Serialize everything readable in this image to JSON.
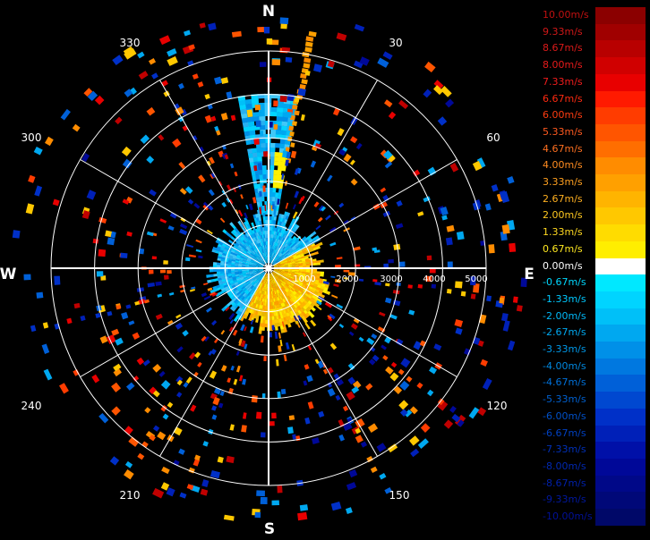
{
  "compass": {
    "north": "N",
    "east": "E",
    "south": "S",
    "west": "W"
  },
  "azimuth_labels": [
    "30",
    "60",
    "120",
    "150",
    "210",
    "240",
    "300",
    "330"
  ],
  "range_labels": [
    "1000",
    "2000",
    "3000",
    "4000",
    "5000"
  ],
  "colors": {
    "background": "#000000",
    "grid": "#ffffff",
    "zero": "#ffffff"
  },
  "legend": [
    {
      "label": "10.00m/s",
      "color": "#8b0000",
      "text_color": "#c01010"
    },
    {
      "label": "9.33m/s",
      "color": "#a00000",
      "text_color": "#d01818"
    },
    {
      "label": "8.67m/s",
      "color": "#b80000",
      "text_color": "#dc1a1a"
    },
    {
      "label": "8.00m/s",
      "color": "#d00000",
      "text_color": "#e81a1a"
    },
    {
      "label": "7.33m/s",
      "color": "#e80000",
      "text_color": "#f01c1c"
    },
    {
      "label": "6.67m/s",
      "color": "#ff1a00",
      "text_color": "#ff2a10"
    },
    {
      "label": "6.00m/s",
      "color": "#ff3c00",
      "text_color": "#ff3c10"
    },
    {
      "label": "5.33m/s",
      "color": "#ff5500",
      "text_color": "#ff5a20"
    },
    {
      "label": "4.67m/s",
      "color": "#ff6e00",
      "text_color": "#ff7020"
    },
    {
      "label": "4.00m/s",
      "color": "#ff8c00",
      "text_color": "#ff8c20"
    },
    {
      "label": "3.33m/s",
      "color": "#ffa000",
      "text_color": "#ffa020"
    },
    {
      "label": "2.67m/s",
      "color": "#ffb400",
      "text_color": "#ffb020"
    },
    {
      "label": "2.00m/s",
      "color": "#ffc800",
      "text_color": "#ffc820"
    },
    {
      "label": "1.33m/s",
      "color": "#ffdc00",
      "text_color": "#ffd820"
    },
    {
      "label": "0.67m/s",
      "color": "#ffee00",
      "text_color": "#ffe820"
    },
    {
      "label": "0.00m/s",
      "color": "#ffffff",
      "text_color": "#ffffff"
    },
    {
      "label": "-0.67m/s",
      "color": "#00e8ff",
      "text_color": "#00d8ff"
    },
    {
      "label": "-1.33m/s",
      "color": "#00d4ff",
      "text_color": "#00c8ff"
    },
    {
      "label": "-2.00m/s",
      "color": "#00c0f8",
      "text_color": "#00b8f8"
    },
    {
      "label": "-2.67m/s",
      "color": "#00a8f0",
      "text_color": "#00a8f0"
    },
    {
      "label": "-3.33m/s",
      "color": "#0090e8",
      "text_color": "#0098e8"
    },
    {
      "label": "-4.00m/s",
      "color": "#0078e0",
      "text_color": "#0088e0"
    },
    {
      "label": "-4.67m/s",
      "color": "#0060d8",
      "text_color": "#0070d8"
    },
    {
      "label": "-5.33m/s",
      "color": "#0048d0",
      "text_color": "#0060d0"
    },
    {
      "label": "-6.00m/s",
      "color": "#0030c8",
      "text_color": "#0050c8"
    },
    {
      "label": "-6.67m/s",
      "color": "#0020b8",
      "text_color": "#0040c0"
    },
    {
      "label": "-7.33m/s",
      "color": "#0010a8",
      "text_color": "#0030b8"
    },
    {
      "label": "-8.00m/s",
      "color": "#000898",
      "text_color": "#0028b0"
    },
    {
      "label": "-8.67m/s",
      "color": "#000888",
      "text_color": "#0020a8"
    },
    {
      "label": "-9.33m/s",
      "color": "#000878",
      "text_color": "#0018a0"
    },
    {
      "label": "-10.00m/s",
      "color": "#000868",
      "text_color": "#001098"
    }
  ]
}
